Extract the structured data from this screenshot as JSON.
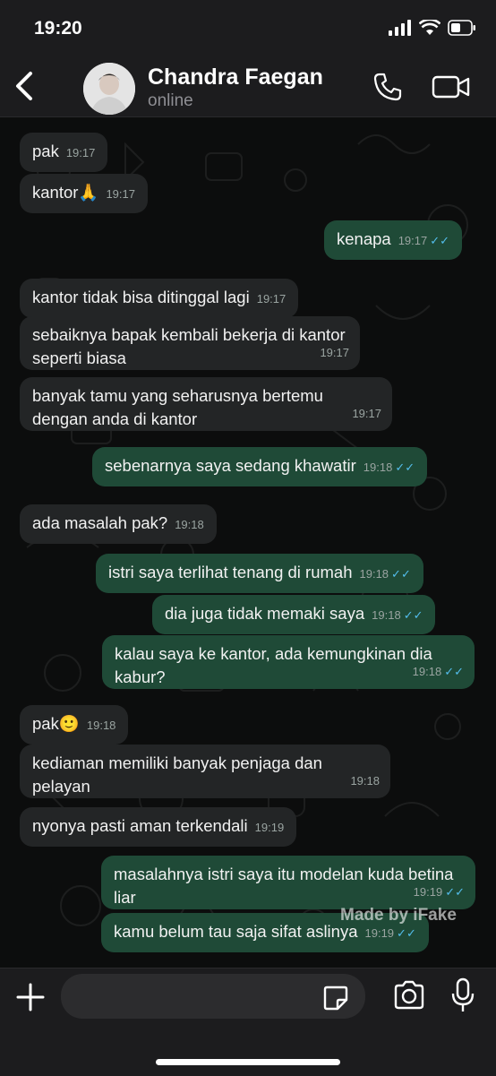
{
  "status_bar": {
    "time": "19:20"
  },
  "header": {
    "contact_name": "Chandra Faegan",
    "contact_status": "online"
  },
  "messages": [
    {
      "dir": "in",
      "text": "pak",
      "time": "19:17"
    },
    {
      "dir": "in",
      "text": "kantor🙏",
      "time": "19:17"
    },
    {
      "dir": "out",
      "text": "kenapa",
      "time": "19:17"
    },
    {
      "dir": "in",
      "text": "kantor tidak bisa ditinggal lagi",
      "time": "19:17"
    },
    {
      "dir": "in",
      "text": "sebaiknya bapak kembali bekerja di kantor seperti biasa",
      "time": "19:17"
    },
    {
      "dir": "in",
      "text": "banyak tamu yang seharusnya bertemu dengan anda di kantor",
      "time": "19:17"
    },
    {
      "dir": "out",
      "text": "sebenarnya saya sedang khawatir",
      "time": "19:18"
    },
    {
      "dir": "in",
      "text": "ada masalah pak?",
      "time": "19:18"
    },
    {
      "dir": "out",
      "text": "istri saya terlihat tenang di rumah",
      "time": "19:18"
    },
    {
      "dir": "out",
      "text": "dia juga tidak memaki saya",
      "time": "19:18"
    },
    {
      "dir": "out",
      "text": "kalau saya ke kantor, ada kemungkinan dia kabur?",
      "time": "19:18"
    },
    {
      "dir": "in",
      "text": "pak🙂",
      "time": "19:18"
    },
    {
      "dir": "in",
      "text": "kediaman memiliki banyak penjaga dan pelayan",
      "time": "19:18"
    },
    {
      "dir": "in",
      "text": "nyonya pasti aman terkendali",
      "time": "19:19"
    },
    {
      "dir": "out",
      "text": "masalahnya istri saya itu modelan kuda betina liar",
      "time": "19:19"
    },
    {
      "dir": "out",
      "text": "kamu belum tau saja sifat aslinya",
      "time": "19:19"
    }
  ],
  "watermark": "Made by iFake",
  "composer": {
    "placeholder": ""
  },
  "icons": {
    "back": "chevron-left-icon",
    "call": "phone-icon",
    "video": "video-camera-icon",
    "plus": "plus-icon",
    "sticker": "sticker-icon",
    "camera": "camera-icon",
    "mic": "microphone-icon"
  },
  "colors": {
    "incoming_bubble": "#232526",
    "outgoing_bubble": "#1f4a37",
    "read_ticks": "#53bdeb",
    "bar_background": "#1c1c1e"
  }
}
